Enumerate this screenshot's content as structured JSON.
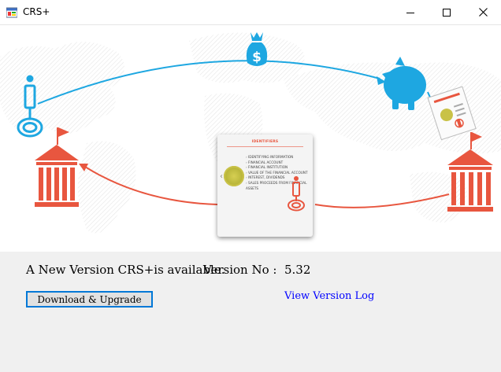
{
  "window": {
    "title": "CRS+",
    "icons": {
      "app": "app-window-icon",
      "minimize": "minimize-icon",
      "maximize": "maximize-icon",
      "close": "close-icon"
    }
  },
  "banner": {
    "card": {
      "title": "IDENTIFIERS",
      "items": [
        "IDENTIFYING INFORMATION",
        "FINANCIAL ACCOUNT",
        "FINANCIAL INSTITUTION",
        "VALUE OF THE FINANCIAL ACCOUNT",
        "INTEREST, DIVIDENDS",
        "SALES PROCEEDS FROM FINANCIAL ASSETS"
      ]
    },
    "colors": {
      "blue": "#1ea7e1",
      "red": "#e8563f"
    },
    "icons": [
      "person-icon",
      "money-bag-icon",
      "piggy-bank-icon",
      "document-icon",
      "bank-icon"
    ]
  },
  "update": {
    "message": "A New Version CRS+is available.",
    "version_label": "Version No :",
    "version_value": "5.32",
    "download_label": "Download & Upgrade",
    "view_log_label": "View Version Log"
  }
}
